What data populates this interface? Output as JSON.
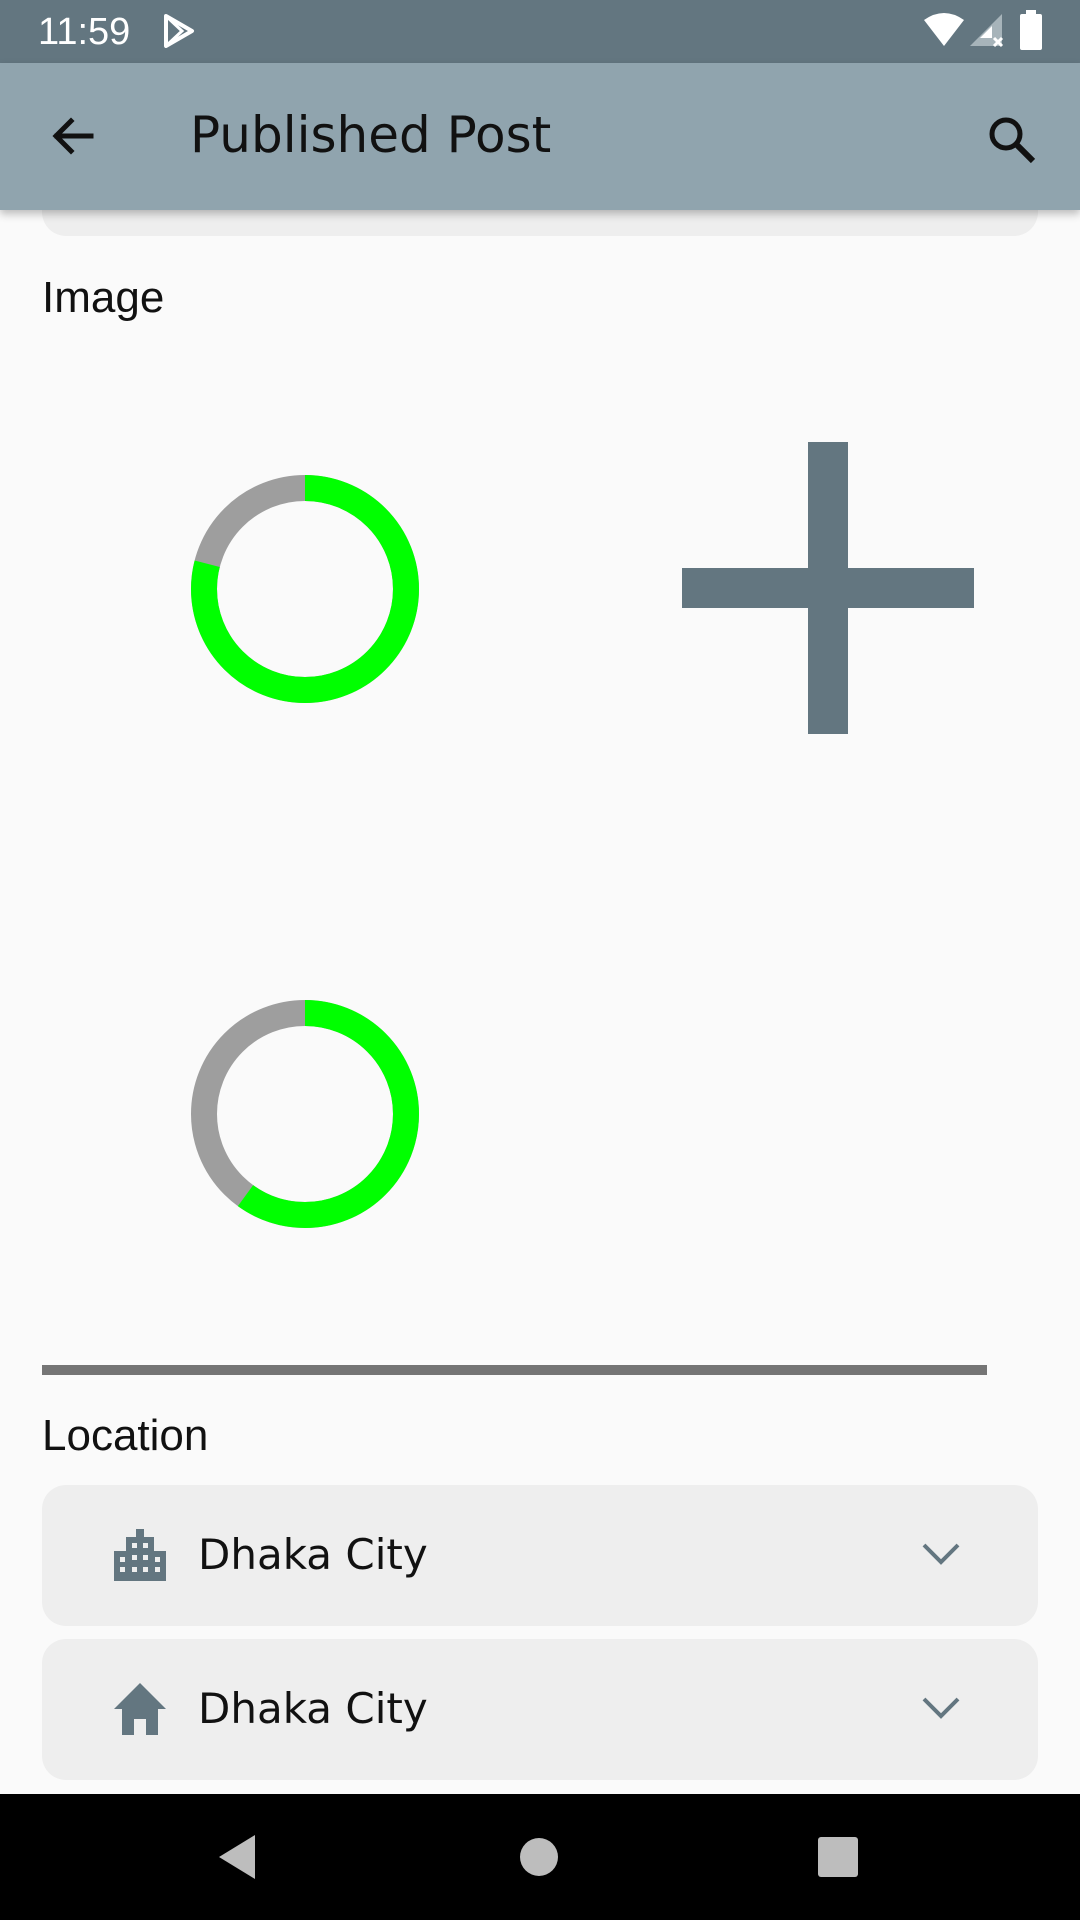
{
  "status_bar": {
    "time": "11:59",
    "icons": [
      "play-store-icon",
      "wifi-icon",
      "signal-icon",
      "battery-icon"
    ]
  },
  "app_bar": {
    "title": "Published Post",
    "back_icon": "arrow-back-icon",
    "search_icon": "search-icon",
    "background": "#90a4ae"
  },
  "image_section": {
    "label": "Image",
    "uploads": [
      {
        "progress": 0.79
      },
      {
        "progress": 0.6
      }
    ],
    "add_icon": "add-icon",
    "progress_color": "#00ff00",
    "track_color": "#9e9e9e"
  },
  "location_section": {
    "label": "Location",
    "fields": [
      {
        "icon": "city-icon",
        "value": "Dhaka City"
      },
      {
        "icon": "home-icon",
        "value": "Dhaka City"
      }
    ]
  },
  "nav_bar": {
    "icons": [
      "nav-back-icon",
      "nav-home-icon",
      "nav-recents-icon"
    ]
  },
  "colors": {
    "accent": "#637680",
    "progress": "#00ff00"
  }
}
